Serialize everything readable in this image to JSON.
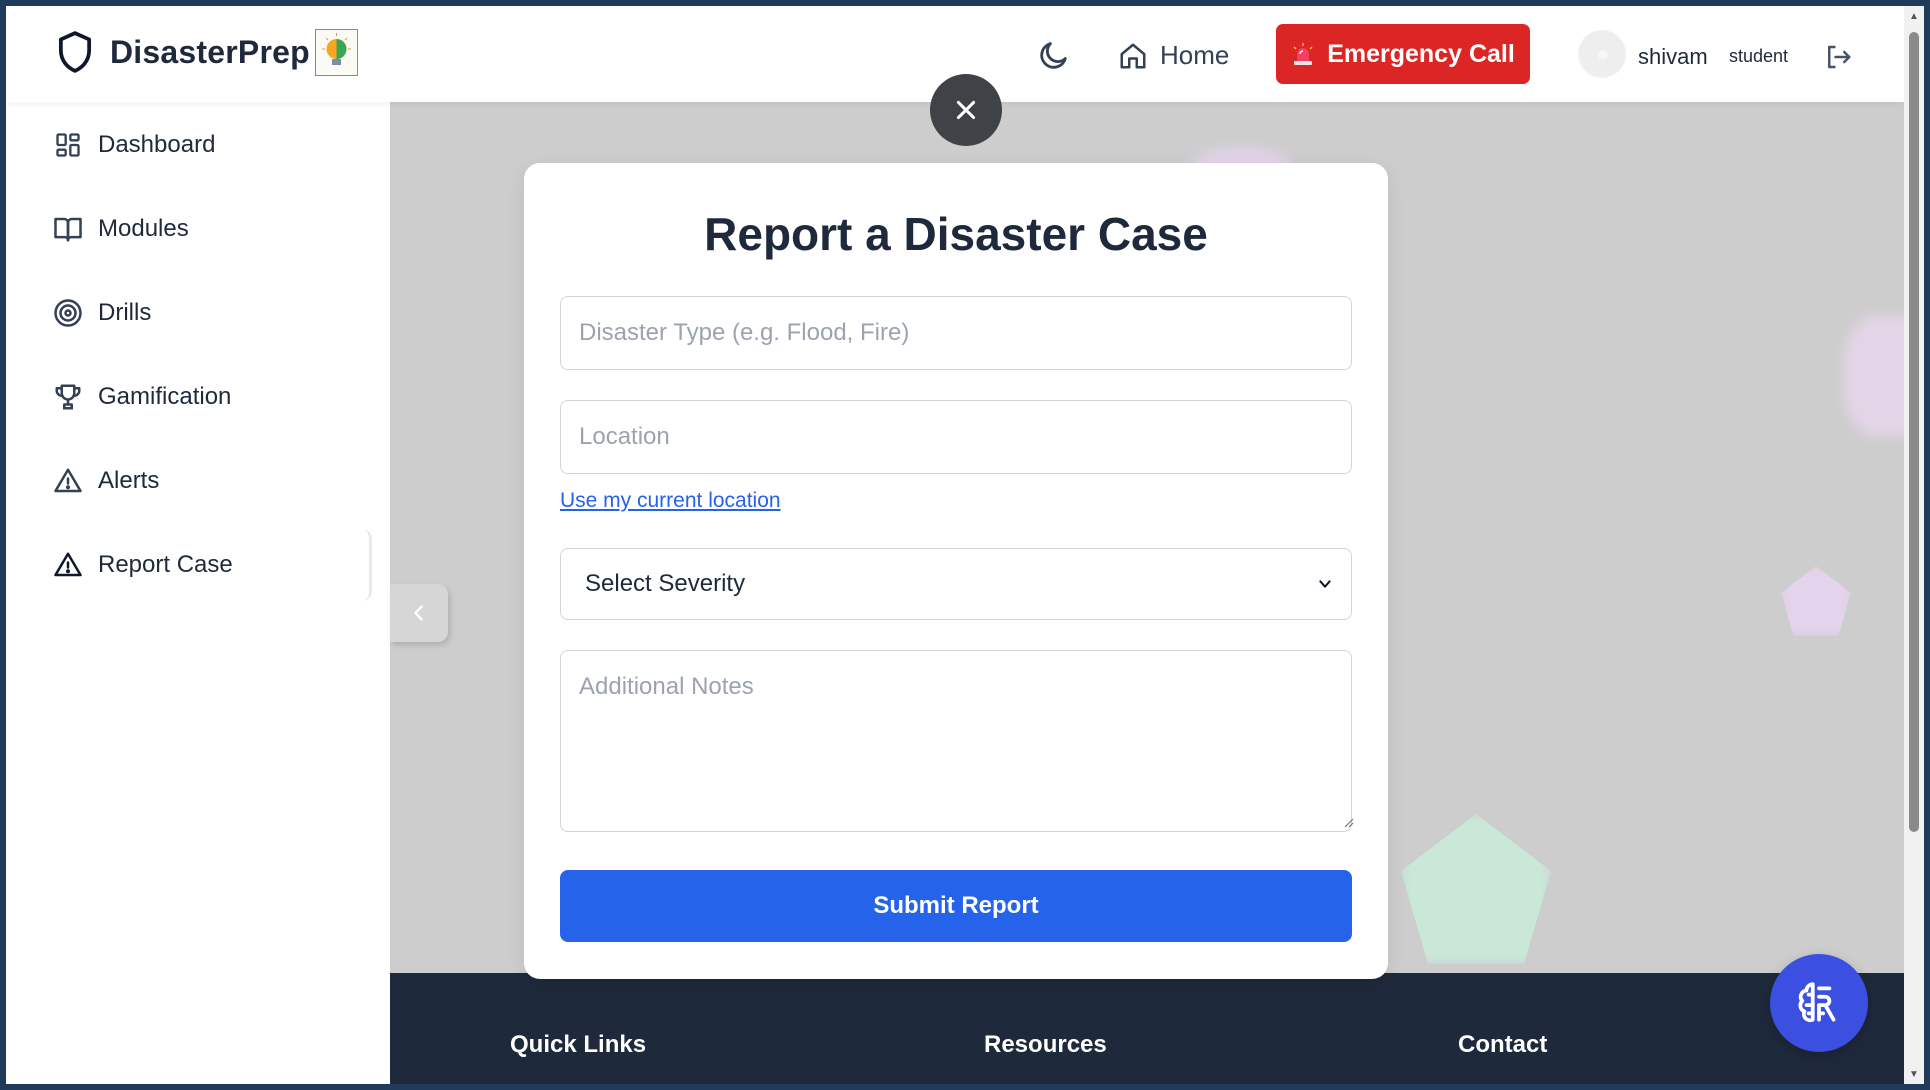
{
  "header": {
    "brand_name": "DisasterPrep",
    "home_label": "Home",
    "emergency_label": "Emergency Call",
    "username": "shivam",
    "role": "student",
    "emergency_color": "#dc2626"
  },
  "sidebar": {
    "items": [
      {
        "label": "Dashboard",
        "icon": "dashboard-grid-icon"
      },
      {
        "label": "Modules",
        "icon": "book-open-icon"
      },
      {
        "label": "Drills",
        "icon": "target-icon"
      },
      {
        "label": "Gamification",
        "icon": "trophy-icon"
      },
      {
        "label": "Alerts",
        "icon": "warning-triangle-icon"
      },
      {
        "label": "Report Case",
        "icon": "warning-triangle-icon"
      }
    ],
    "active": "Report Case"
  },
  "modal": {
    "title": "Report a Disaster Case",
    "disaster_type_placeholder": "Disaster Type (e.g. Flood, Fire)",
    "location_placeholder": "Location",
    "use_location_link": "Use my current location",
    "severity_selected": "Select Severity",
    "notes_placeholder": "Additional Notes",
    "submit_label": "Submit Report",
    "submit_color": "#2563eb"
  },
  "footer": {
    "quick_links": "Quick Links",
    "resources": "Resources",
    "contact": "Contact"
  }
}
